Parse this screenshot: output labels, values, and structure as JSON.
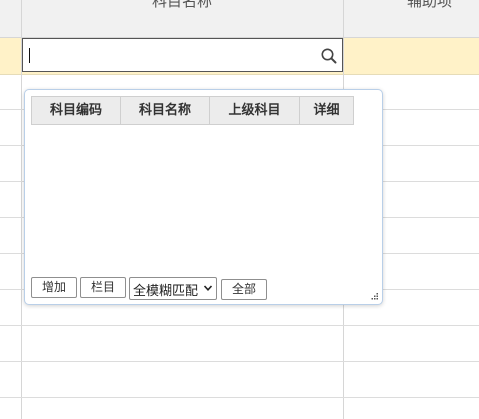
{
  "grid": {
    "header_col1": "科目名称",
    "header_col2": "辅助项"
  },
  "search": {
    "value": "",
    "placeholder": ""
  },
  "panel": {
    "columns": [
      "科目编码",
      "科目名称",
      "上级科目",
      "详细"
    ],
    "buttons": {
      "add": "增加",
      "columns": "栏目",
      "all": "全部"
    },
    "match_mode": {
      "selected": "全模糊匹配"
    }
  },
  "colors": {
    "header_bg": "#f1f1f1",
    "highlight_row": "#fff2c8",
    "panel_border": "#b9cfe8",
    "column_header_bg": "#ececec"
  },
  "icons": [
    "search-icon",
    "chevron-down-icon",
    "resize-grip-icon"
  ]
}
